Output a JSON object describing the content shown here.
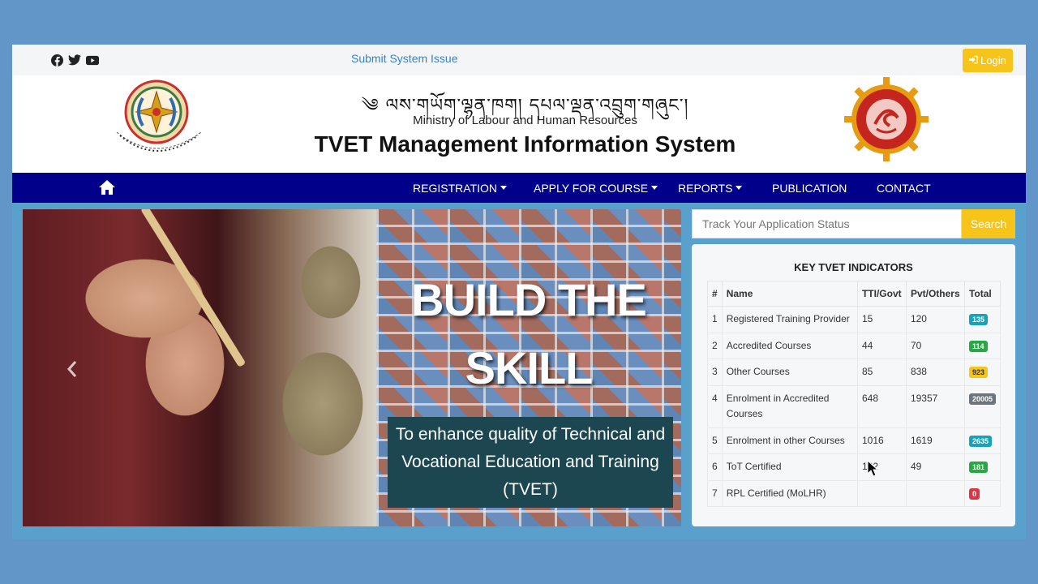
{
  "topbar": {
    "social_icons": [
      "facebook-icon",
      "twitter-icon",
      "youtube-icon"
    ],
    "submit_issue": "Submit System Issue",
    "login": "Login"
  },
  "header": {
    "dzongkha_title": "༄ ལས་གཡོག་ལྷན་ཁག། དཔལ་ལྡན་འབྲུག་གཞུང་།",
    "ministry": "Ministry of Labour and Human Resources",
    "system_name": "TVET Management Information System"
  },
  "nav": {
    "items": [
      {
        "label": "REGISTRATION",
        "dropdown": true
      },
      {
        "label": "APPLY FOR COURSE",
        "dropdown": true
      },
      {
        "label": "REPORTS",
        "dropdown": true
      },
      {
        "label": "PUBLICATION",
        "dropdown": false
      },
      {
        "label": "CONTACT",
        "dropdown": false
      }
    ]
  },
  "banner": {
    "headline_line1": "BUILD THE",
    "headline_line2": "SKILL",
    "tagline_line1": "To enhance quality of Technical and",
    "tagline_line2": "Vocational Education and Training",
    "tagline_line3": "(TVET)"
  },
  "track": {
    "placeholder": "Track Your Application Status",
    "button": "Search"
  },
  "indicators": {
    "title": "KEY TVET INDICATORS",
    "columns": [
      "#",
      "Name",
      "TTI/Govt",
      "Pvt/Others",
      "Total"
    ],
    "rows": [
      {
        "no": "1",
        "name": "Registered Training Provider",
        "govt": "15",
        "pvt": "120",
        "total": "135",
        "badge_color": "#17a2b8"
      },
      {
        "no": "2",
        "name": "Accredited Courses",
        "govt": "44",
        "pvt": "70",
        "total": "114",
        "badge_color": "#28a745"
      },
      {
        "no": "3",
        "name": "Other Courses",
        "govt": "85",
        "pvt": "838",
        "total": "923",
        "badge_color": "#f7c41a"
      },
      {
        "no": "4",
        "name": "Enrolment in Accredited Courses",
        "govt": "648",
        "pvt": "19357",
        "total": "20005",
        "badge_color": "#6c757d"
      },
      {
        "no": "5",
        "name": "Enrolment in other Courses",
        "govt": "1016",
        "pvt": "1619",
        "total": "2635",
        "badge_color": "#17a2b8"
      },
      {
        "no": "6",
        "name": "ToT Certified",
        "govt": "132",
        "pvt": "49",
        "total": "181",
        "badge_color": "#28a745"
      },
      {
        "no": "7",
        "name": "RPL Certified (MoLHR)",
        "govt": "",
        "pvt": "",
        "total": "0",
        "badge_color": "#dc3545"
      }
    ]
  },
  "colors": {
    "nav_bg": "#00008b",
    "accent_yellow": "#f7c41a",
    "link_blue": "#3b82c4",
    "page_bg": "#6396c8"
  }
}
